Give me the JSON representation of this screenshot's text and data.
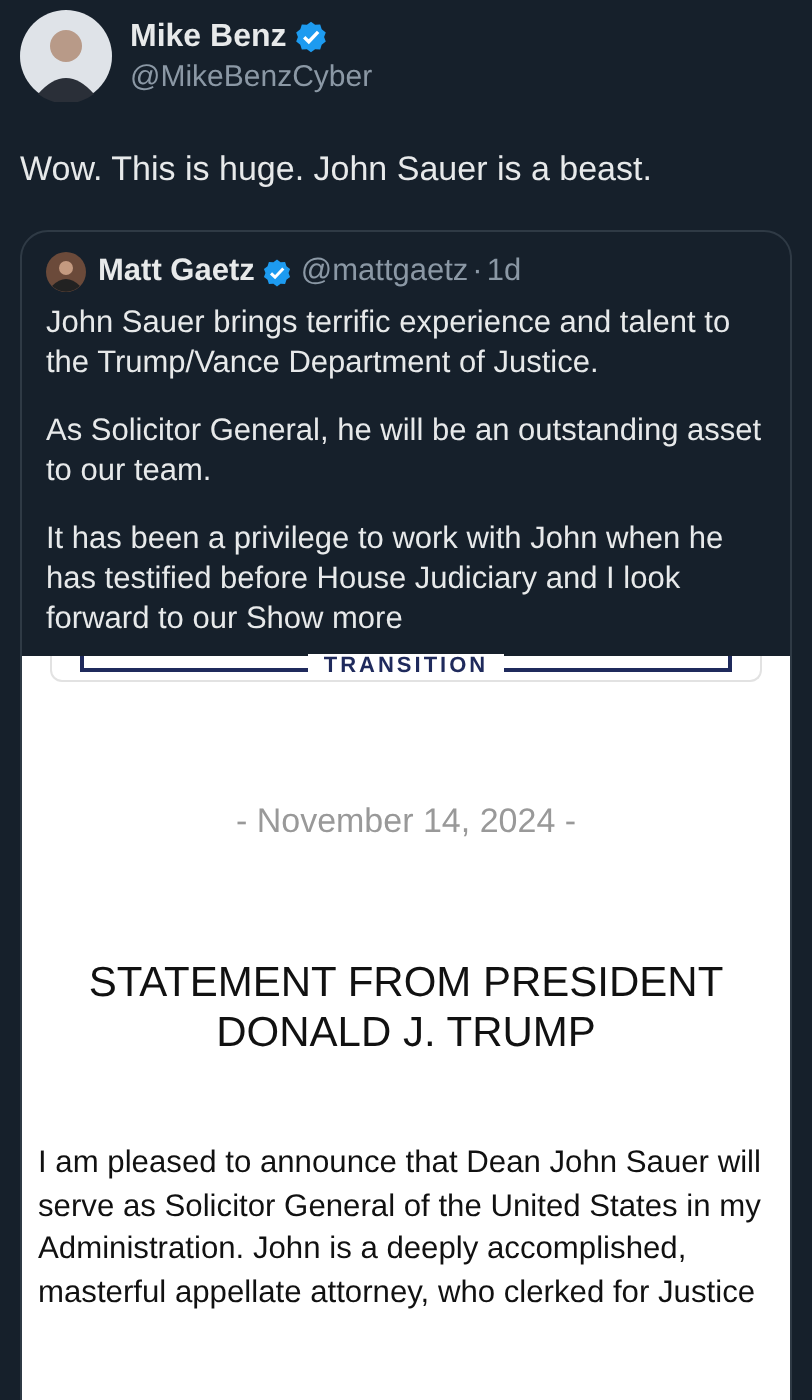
{
  "author": {
    "name": "Mike Benz",
    "verified": true,
    "handle": "@MikeBenzCyber"
  },
  "text": "Wow. This is huge. John Sauer is a beast.",
  "quote": {
    "name": "Matt Gaetz",
    "verified": true,
    "handle": "@mattgaetz",
    "separator": "·",
    "time": "1d",
    "paragraphs": [
      "John Sauer brings terrific experience and talent to the Trump/Vance Department of Justice.",
      "As Solicitor General, he will be an outstanding asset to our team.",
      "It has been a privilege to work with John when he has testified before House Judiciary and I look forward to our"
    ],
    "show_more": "Show more"
  },
  "document": {
    "banner": "TRANSITION",
    "date": "- November 14, 2024 -",
    "title": "STATEMENT FROM PRESIDENT DONALD J. TRUMP",
    "body": "I am pleased to announce that Dean John Sauer will serve as Solicitor General of the United States in my Administration. John is a deeply accomplished, masterful appellate attorney, who clerked for Justice"
  }
}
